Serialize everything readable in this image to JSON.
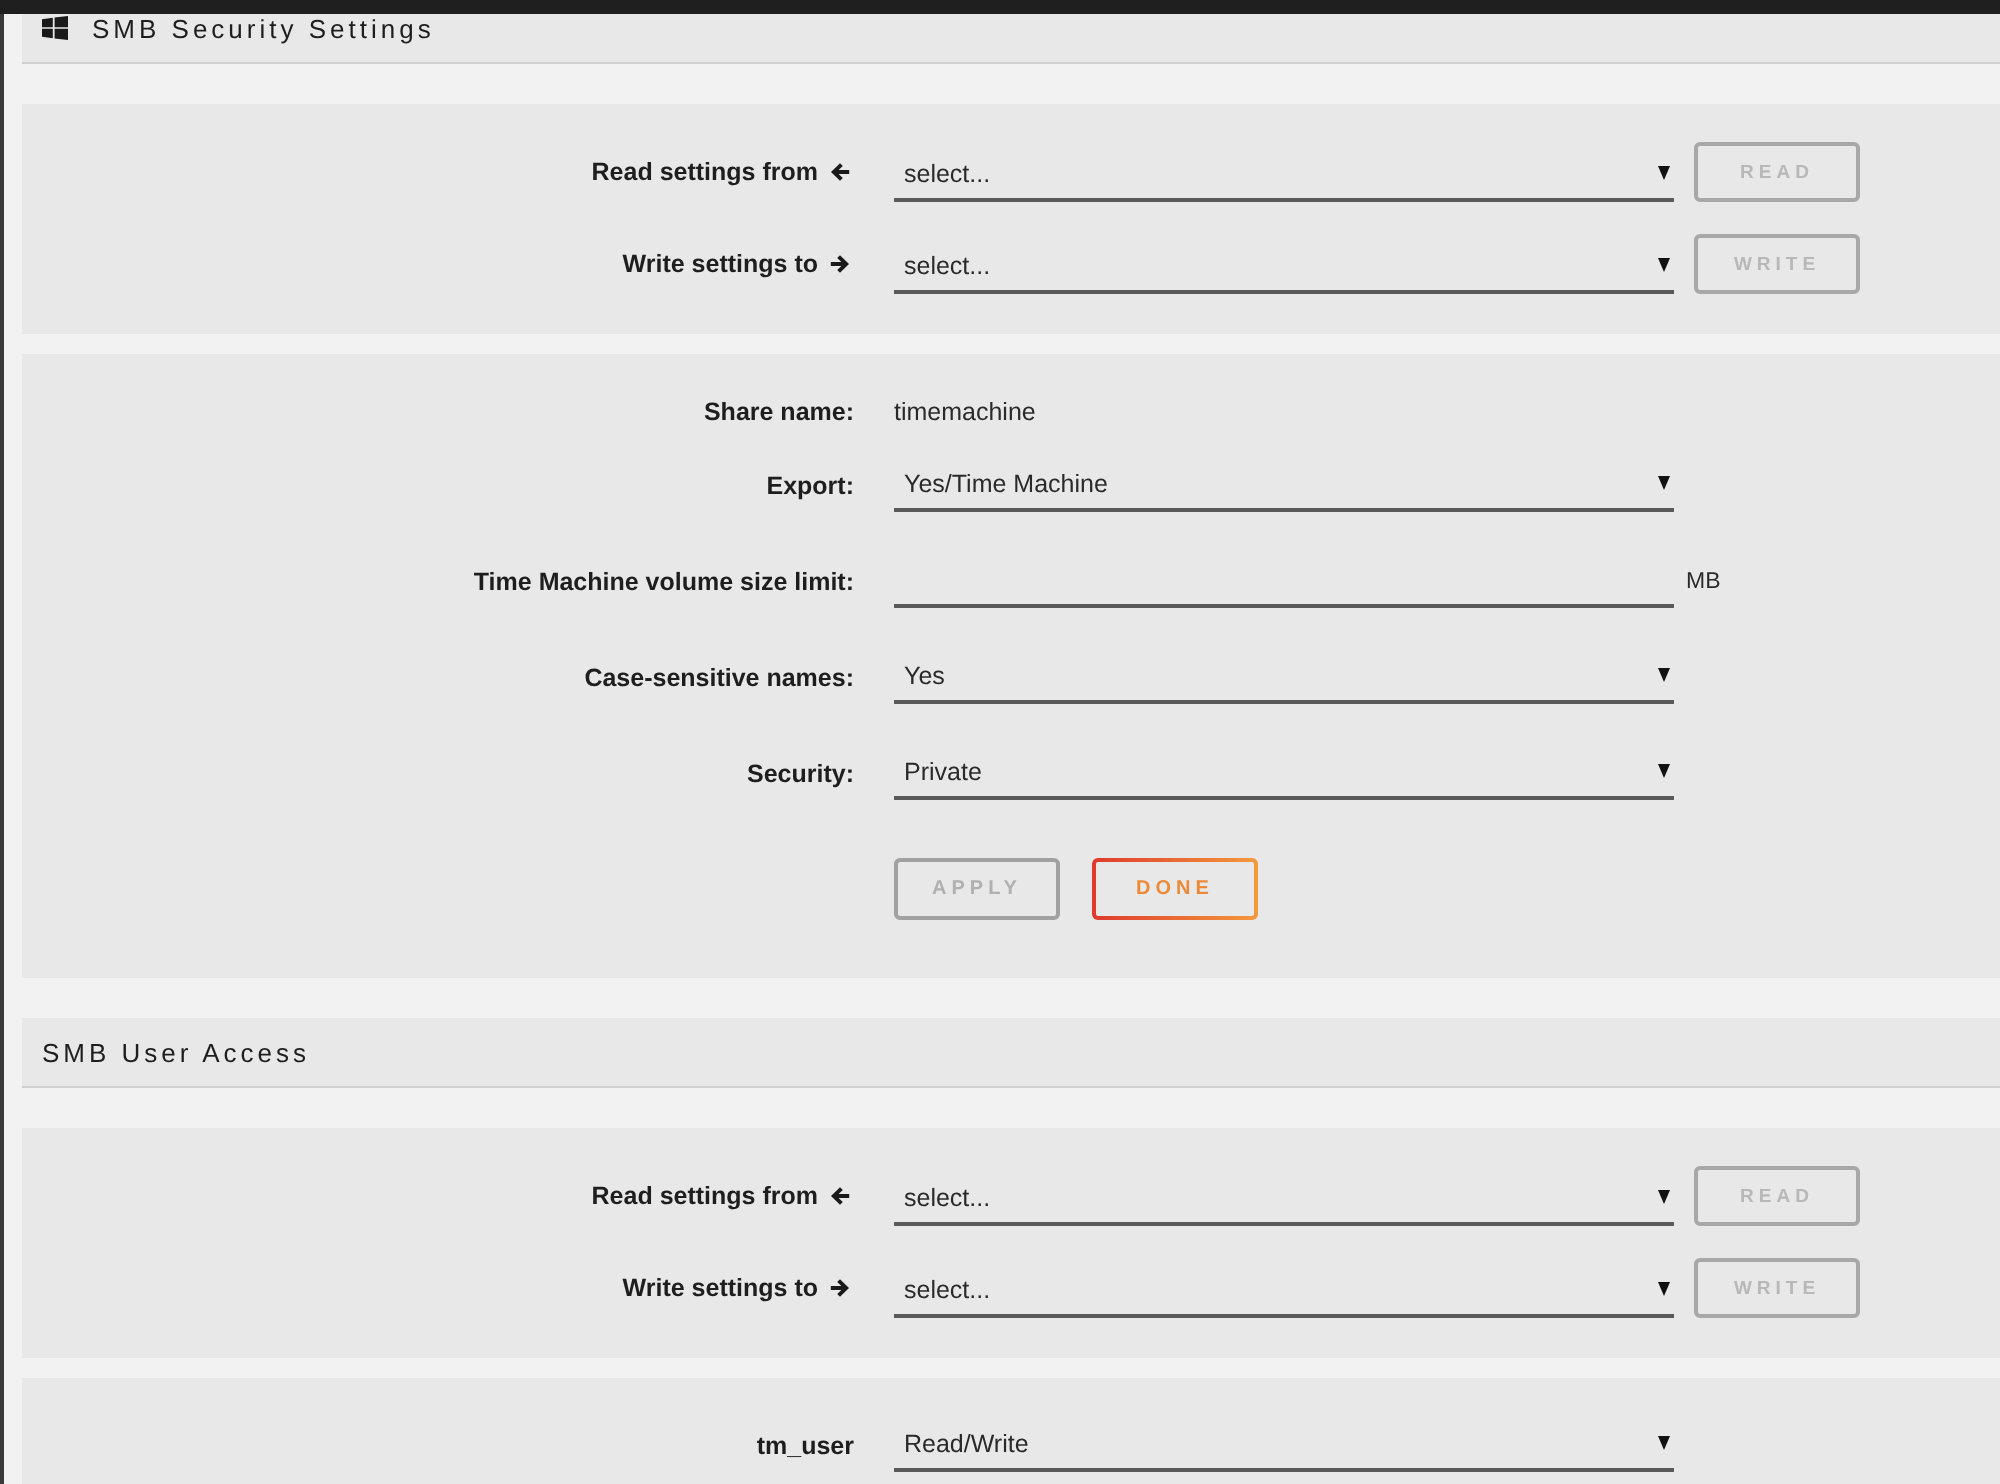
{
  "sections": [
    {
      "title": "SMB Security Settings",
      "icon_shown": true,
      "copy_rows": [
        {
          "kind": "read",
          "label": "Read settings from",
          "value": "select...",
          "button": "READ",
          "disabled": true
        },
        {
          "kind": "write",
          "label": "Write settings to",
          "value": "select...",
          "button": "WRITE",
          "disabled": true
        }
      ],
      "fields": [
        {
          "kind": "text",
          "label": "Share name:",
          "value": "timemachine"
        },
        {
          "kind": "select",
          "label": "Export:",
          "value": "Yes/Time Machine"
        },
        {
          "kind": "input",
          "label": "Time Machine volume size limit:",
          "unit": "MB"
        },
        {
          "kind": "select",
          "label": "Case-sensitive names:",
          "value": "Yes"
        },
        {
          "kind": "select",
          "label": "Security:",
          "value": "Private"
        }
      ],
      "actions": [
        {
          "label": "APPLY",
          "disabled": true
        },
        {
          "label": "DONE",
          "disabled": false
        }
      ]
    },
    {
      "title": "SMB User Access",
      "icon_shown": false,
      "copy_rows": [
        {
          "kind": "read",
          "label": "Read settings from",
          "value": "select...",
          "button": "READ",
          "disabled": true
        },
        {
          "kind": "write",
          "label": "Write settings to",
          "value": "select...",
          "button": "WRITE",
          "disabled": true
        }
      ],
      "fields": [
        {
          "kind": "select",
          "label": "tm_user",
          "value": "Read/Write"
        }
      ]
    }
  ]
}
